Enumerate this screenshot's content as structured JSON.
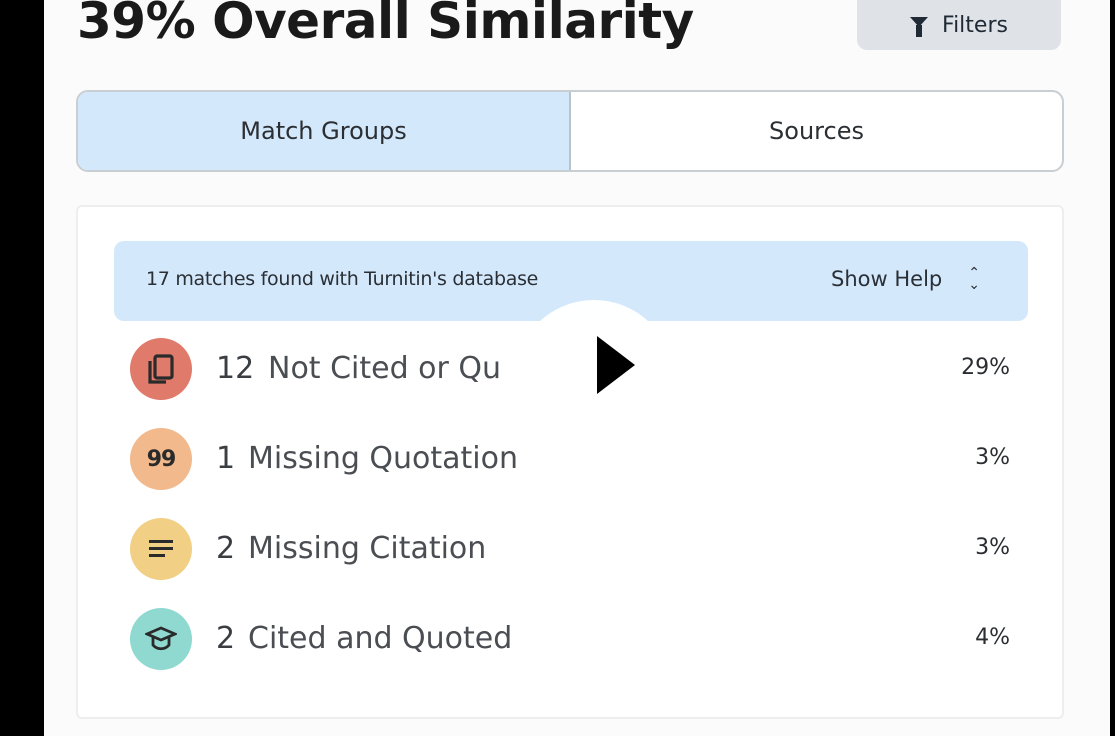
{
  "header": {
    "title": "39% Overall Similarity",
    "filters_label": "Filters"
  },
  "tabs": [
    {
      "label": "Match Groups",
      "active": true
    },
    {
      "label": "Sources",
      "active": false
    }
  ],
  "banner": {
    "text": "17 matches found with Turnitin's database",
    "help_label": "Show Help"
  },
  "groups": [
    {
      "count": "12",
      "label": "Not Cited or Qu",
      "percent": "29%",
      "icon": "pages-icon",
      "color": "#e07a6b"
    },
    {
      "count": "1",
      "label": "Missing Quotation",
      "percent": "3%",
      "icon": "quote-icon",
      "color": "#f2b98c"
    },
    {
      "count": "2",
      "label": "Missing Citation",
      "percent": "3%",
      "icon": "lines-icon",
      "color": "#f1cf85"
    },
    {
      "count": "2",
      "label": "Cited and Quoted",
      "percent": "4%",
      "icon": "graduation-cap-icon",
      "color": "#8fd9d0"
    }
  ],
  "overlay": {
    "icon": "play-icon"
  }
}
